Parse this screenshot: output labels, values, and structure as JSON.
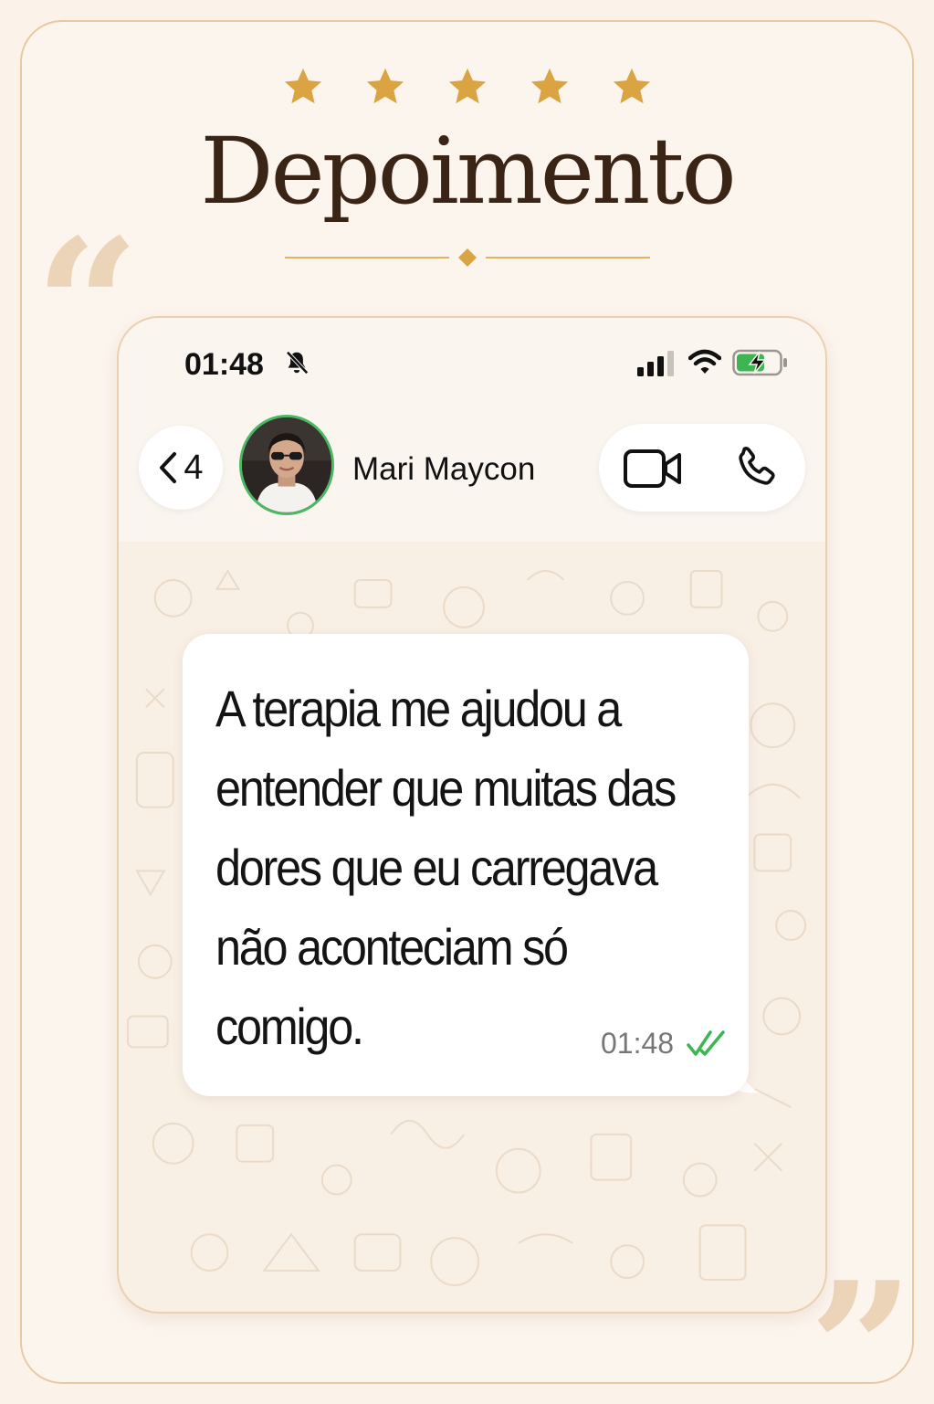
{
  "rating": {
    "stars": 5,
    "star_color": "#d9a441"
  },
  "heading": {
    "title": "Depoimento"
  },
  "status_bar": {
    "time": "01:48",
    "signal_bars": 3,
    "battery_charging": true
  },
  "chat_header": {
    "back_count": "4",
    "contact_name": "Mari Maycon",
    "icons": [
      "chevron-left-icon",
      "video-call-icon",
      "phone-call-icon"
    ]
  },
  "message": {
    "text": "A terapia me ajudou a\nentender que muitas das\ndores que eu carregava\nnão aconteciam só\ncomigo.",
    "time": "01:48",
    "status": "read"
  },
  "colors": {
    "accent_gold": "#d9a441",
    "background": "#fbf3ea",
    "read_ticks": "#3cb653",
    "title": "#3a2416"
  }
}
